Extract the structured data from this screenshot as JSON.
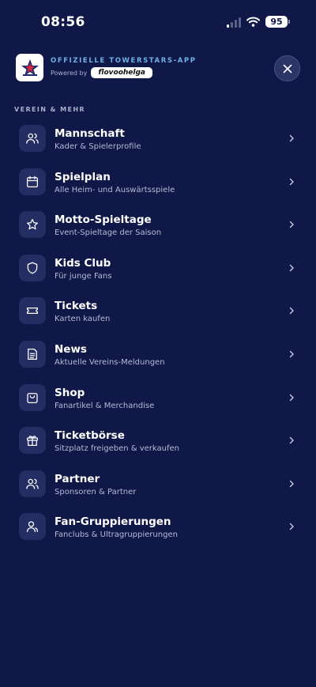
{
  "status_bar": {
    "time": "08:56",
    "battery": "95",
    "signal_bars_active": 1,
    "signal_bars_total": 4
  },
  "header": {
    "brand_title": "OFFIZIELLE TOWERSTARS-APP",
    "powered_by": "Powered by",
    "powered_badge": "flovoohelga"
  },
  "section": {
    "label": "VEREIN & MEHR"
  },
  "menu": [
    {
      "title": "Mannschaft",
      "subtitle": "Kader & Spielerprofile",
      "icon": "team-icon"
    },
    {
      "title": "Spielplan",
      "subtitle": "Alle Heim- und Auswärtsspiele",
      "icon": "calendar-icon"
    },
    {
      "title": "Motto-Spieltage",
      "subtitle": "Event-Spieltage der Saison",
      "icon": "star-icon"
    },
    {
      "title": "Kids Club",
      "subtitle": "Für junge Fans",
      "icon": "shield-icon"
    },
    {
      "title": "Tickets",
      "subtitle": "Karten kaufen",
      "icon": "ticket-icon"
    },
    {
      "title": "News",
      "subtitle": "Aktuelle Vereins-Meldungen",
      "icon": "news-icon"
    },
    {
      "title": "Shop",
      "subtitle": "Fanartikel & Merchandise",
      "icon": "shopping-bag-icon"
    },
    {
      "title": "Ticketbörse",
      "subtitle": "Sitzplatz freigeben & verkaufen",
      "icon": "gift-icon"
    },
    {
      "title": "Partner",
      "subtitle": "Sponsoren & Partner",
      "icon": "users-icon"
    },
    {
      "title": "Fan-Gruppierungen",
      "subtitle": "Fanclubs & Ultragruppierungen",
      "icon": "user-group-icon"
    }
  ],
  "colors": {
    "background": "#101848",
    "icon_box": "#252e63",
    "accent": "#6fb0e6"
  }
}
